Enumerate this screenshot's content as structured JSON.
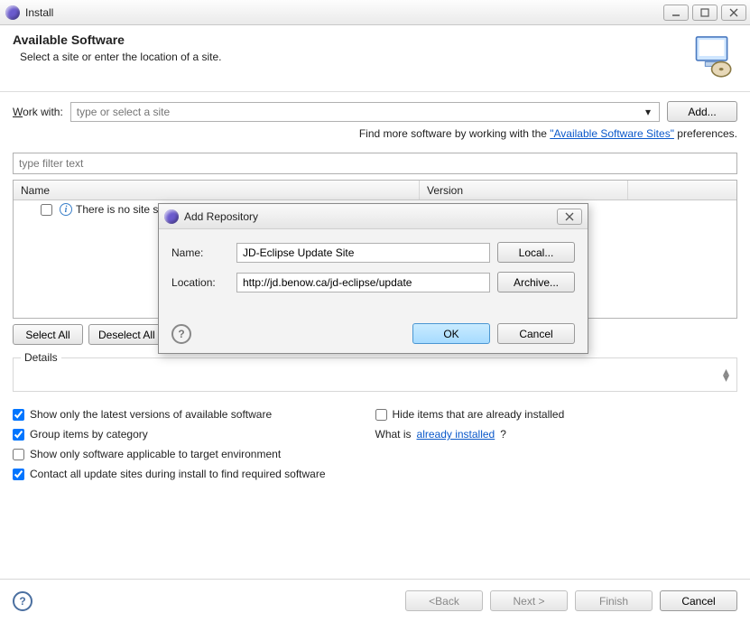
{
  "window": {
    "title": "Install"
  },
  "banner": {
    "heading": "Available Software",
    "subtext": "Select a site or enter the location of a site."
  },
  "workWith": {
    "label_pre": "W",
    "label_post": "ork with:",
    "placeholder": "type or select a site",
    "addButton_pre": "A",
    "addButton_post": "dd..."
  },
  "findMore": {
    "prefix": "Find more software by working with the ",
    "link": "\"Available Software Sites\"",
    "suffix": " preferences."
  },
  "filter": {
    "placeholder": "type filter text"
  },
  "table": {
    "cols": {
      "name": "Name",
      "version": "Version"
    },
    "empty_row": "There is no site selected."
  },
  "selection": {
    "selectAll_pre": "S",
    "selectAll_post": "elect All",
    "deselectAll_pre": "D",
    "deselectAll_post": "eselect All"
  },
  "details": {
    "legend": "Details"
  },
  "options": {
    "latest_pre": "Show only the ",
    "latest_u": "l",
    "latest_post": "atest versions of available software",
    "group_pre": "",
    "group_u": "G",
    "group_post": "roup items by category",
    "applicable": "Show only software applicable to target environment",
    "contact": "Contact all update sites during install to find required software",
    "hide_pre": "",
    "hide_u": "H",
    "hide_post": "ide items that are already installed",
    "whatis_pre": "What is ",
    "whatis_link": "already installed",
    "whatis_post": "?"
  },
  "wizard": {
    "back_pre": "< ",
    "back_u": "B",
    "back_post": "ack",
    "next_pre": "",
    "next_u": "N",
    "next_post": "ext >",
    "finish_pre": "",
    "finish_u": "F",
    "finish_post": "inish",
    "cancel": "Cancel"
  },
  "dialog": {
    "title": "Add Repository",
    "name_label_pre": "",
    "name_label_u": "N",
    "name_label_post": "ame:",
    "name_value": "JD-Eclipse Update Site",
    "local_pre": "",
    "local_u": "L",
    "local_post": "ocal...",
    "loc_label_pre": "",
    "loc_label_u": "L",
    "loc_label_post": "ocation:",
    "loc_value": "http://jd.benow.ca/jd-eclipse/update",
    "archive_pre": "",
    "archive_u": "A",
    "archive_post": "rchive...",
    "ok": "OK",
    "cancel": "Cancel"
  }
}
